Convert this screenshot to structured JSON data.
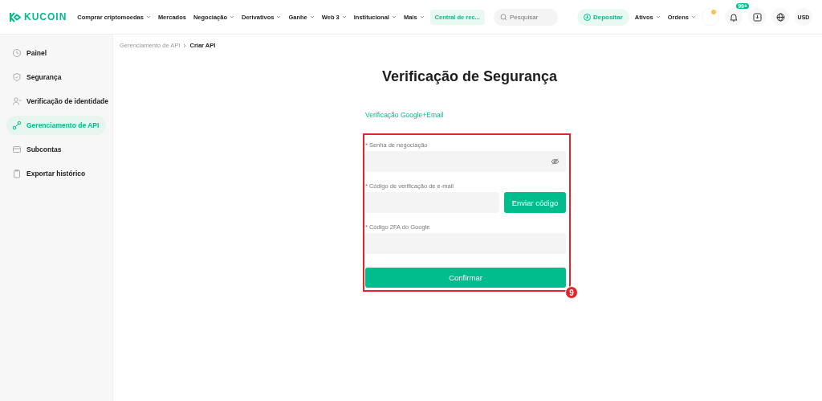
{
  "logo": {
    "text": "KUCOIN"
  },
  "nav": [
    {
      "label": "Comprar criptomoedas",
      "dropdown": true
    },
    {
      "label": "Mercados",
      "dropdown": false
    },
    {
      "label": "Negociação",
      "dropdown": true
    },
    {
      "label": "Derivativos",
      "dropdown": true
    },
    {
      "label": "Ganhe",
      "dropdown": true
    },
    {
      "label": "Web 3",
      "dropdown": true
    },
    {
      "label": "Institucional",
      "dropdown": true
    },
    {
      "label": "Mais",
      "dropdown": true
    }
  ],
  "featured_link": "Central de rec...",
  "search": {
    "placeholder": "Pesquisar"
  },
  "deposit_button": "Depositar",
  "menus": [
    {
      "label": "Ativos",
      "dropdown": true
    },
    {
      "label": "Ordens",
      "dropdown": true
    }
  ],
  "notifications": {
    "badge": "99+"
  },
  "currency": "USD",
  "sidebar": {
    "items": [
      {
        "label": "Painel",
        "selected": false
      },
      {
        "label": "Segurança",
        "selected": false
      },
      {
        "label": "Verificação de identidade",
        "selected": false
      },
      {
        "label": "Gerenciamento de API",
        "selected": true
      },
      {
        "label": "Subcontas",
        "selected": false
      },
      {
        "label": "Exportar histórico",
        "selected": false
      }
    ]
  },
  "breadcrumb": [
    "Gerenciamento de API",
    "Criar API"
  ],
  "title": "Verificação de Segurança",
  "verification_tab": "Verificação Google+Email",
  "form": {
    "required_marker": "*",
    "fields": [
      {
        "label": "Senha de negociação",
        "kind": "password",
        "required": true
      },
      {
        "label": "Código de verificação de e-mail",
        "kind": "code",
        "required": true,
        "button": "Enviar código"
      },
      {
        "label": "Código 2FA do Google",
        "kind": "text",
        "required": true
      }
    ],
    "submit": "Confirmar"
  },
  "annotation": {
    "number": "9"
  }
}
